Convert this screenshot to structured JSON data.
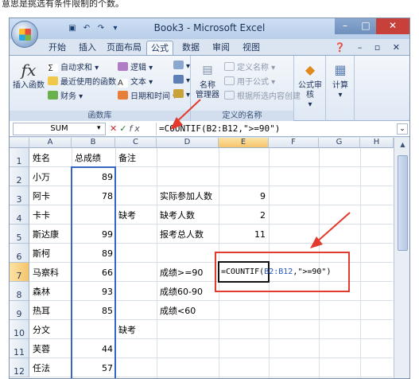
{
  "top_caption": "意思是挑选有条件限制的个数。",
  "title": "Book3 - Microsoft Excel",
  "quick_access": [
    "save",
    "undo",
    "redo",
    "more"
  ],
  "tabs": [
    "开始",
    "插入",
    "页面布局",
    "公式",
    "数据",
    "审阅",
    "视图"
  ],
  "active_tab": "公式",
  "ribbon": {
    "insert_function": "插入函数",
    "autosum": "自动求和",
    "recent": "最近使用的函数",
    "finance": "财务",
    "logic": "逻辑",
    "text": "文本",
    "datetime": "日期和时间",
    "function_library": "函数库",
    "name_manager_1": "名称",
    "name_manager_2": "管理器",
    "define_name": "定义名称",
    "use_in_formula": "用于公式",
    "create_from_selection": "根据所选内容创建",
    "defined_names": "定义的名称",
    "formula_audit_1": "公式审核",
    "calculate": "计算"
  },
  "formula_bar": {
    "name_box": "SUM",
    "formula": "=COUNTIF(B2:B12,\">=90\")"
  },
  "columns": [
    "A",
    "B",
    "C",
    "D",
    "E",
    "F",
    "G",
    "H"
  ],
  "rows": [
    "1",
    "2",
    "3",
    "4",
    "5",
    "6",
    "7",
    "8",
    "9",
    "10",
    "11",
    "12"
  ],
  "cells": {
    "A1": "姓名",
    "B1": "总成绩",
    "C1": "备注",
    "A2": "小万",
    "B2": "89",
    "A3": "阿卡",
    "B3": "78",
    "D3": "实际参加人数",
    "E3": "9",
    "A4": "卡卡",
    "C4": "缺考",
    "D4": "缺考人数",
    "E4": "2",
    "A5": "斯达康",
    "B5": "99",
    "D5": "报考总人数",
    "E5": "11",
    "A6": "斯柯",
    "B6": "89",
    "A7": "马察科",
    "B7": "66",
    "D7": "成绩>=90",
    "A8": "森林",
    "B8": "93",
    "D8": "成绩60-90",
    "A9": "热耳",
    "B9": "85",
    "D9": "成绩<60",
    "A10": "分文",
    "C10": "缺考",
    "A11": "芙蓉",
    "B11": "44",
    "A12": "任法",
    "B12": "57"
  },
  "edit_cell": {
    "prefix": "=COUNTIF(",
    "ref": "B2:B12",
    "suffix": ",\">=90\")"
  }
}
